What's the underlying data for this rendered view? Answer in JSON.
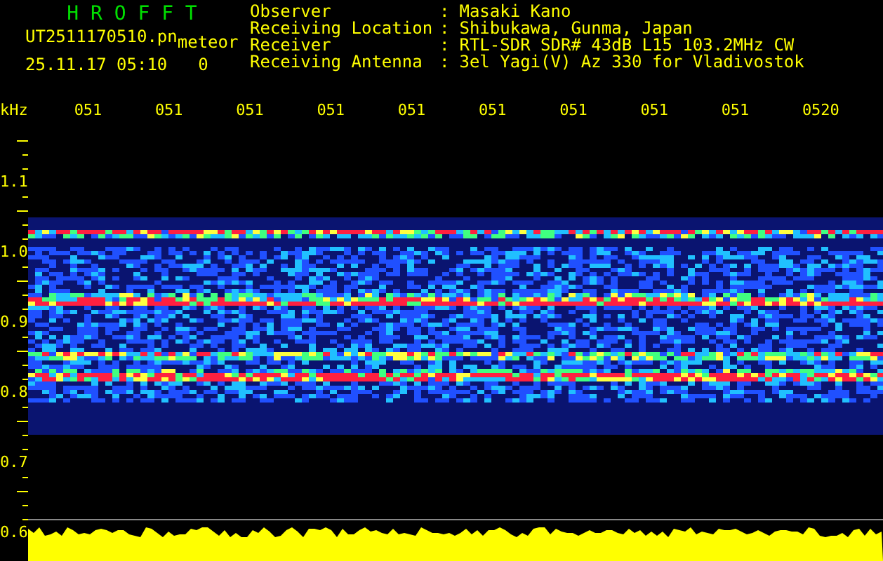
{
  "app_title": "H R O F F T",
  "file_name": "UT2511170510.pn",
  "mode": "meteor",
  "timestamp": "25.11.17 05:10",
  "counter": "0",
  "station_info": [
    {
      "label": "Observer",
      "separator": ":",
      "value": "Masaki Kano"
    },
    {
      "label": "Receiving Location",
      "separator": ":",
      "value": "Shibukawa, Gunma, Japan"
    },
    {
      "label": "Receiver",
      "separator": ":",
      "value": "RTL-SDR SDR# 43dB L15 103.2MHz CW"
    },
    {
      "label": "Receiving Antenna",
      "separator": ":",
      "value": "3el Yagi(V) Az 330 for Vladivostok"
    }
  ],
  "unit": "kHz",
  "time_labels": [
    "051",
    "051",
    "051",
    "051",
    "051",
    "051",
    "051",
    "051",
    "051",
    "0520"
  ],
  "frequency_labels": [
    "1.1",
    "1.0",
    "0.9",
    "0.8",
    "0.7",
    "0.6"
  ]
}
